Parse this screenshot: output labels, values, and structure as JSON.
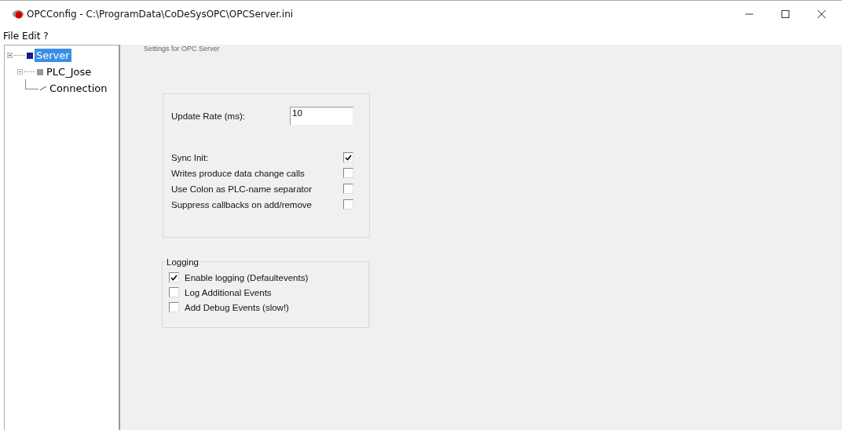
{
  "window": {
    "title": "OPCConfig - C:\\ProgramData\\CoDeSysOPC\\OPCServer.ini"
  },
  "menu": [
    "File",
    "Edit",
    "?"
  ],
  "tree": [
    {
      "label": "Server",
      "selected": true,
      "expanded": true,
      "children": [
        {
          "label": "PLC_Jose",
          "selected": false,
          "expanded": true,
          "children": [
            {
              "label": "Connection",
              "selected": false
            }
          ]
        }
      ]
    }
  ],
  "panel": {
    "title": "Settings for OPC Server",
    "update_rate": {
      "label": "Update Rate (ms):",
      "value": "10"
    },
    "options": [
      {
        "label": "Sync Init:",
        "checked": true
      },
      {
        "label": "Writes produce data change calls",
        "checked": false
      },
      {
        "label": "Use Colon as PLC-name separator",
        "checked": false
      },
      {
        "label": "Suppress callbacks on add/remove",
        "checked": false
      }
    ],
    "logging": {
      "title": "Logging",
      "options": [
        {
          "label": "Enable logging (Defaultevents)",
          "checked": true
        },
        {
          "label": "Log Additional Events",
          "checked": false
        },
        {
          "label": "Add Debug Events (slow!)",
          "checked": false
        }
      ]
    }
  }
}
